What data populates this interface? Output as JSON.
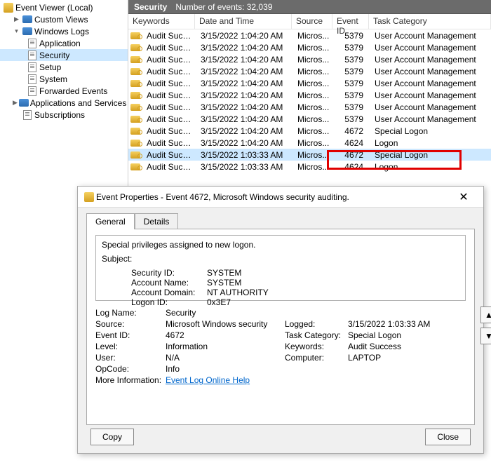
{
  "tree": {
    "root": "Event Viewer (Local)",
    "custom_views": "Custom Views",
    "windows_logs": "Windows Logs",
    "application": "Application",
    "security": "Security",
    "setup": "Setup",
    "system": "System",
    "forwarded": "Forwarded Events",
    "apps_services": "Applications and Services Lo",
    "subscriptions": "Subscriptions"
  },
  "list": {
    "bar_title": "Security",
    "bar_count_label": "Number of events: 32,039",
    "cols": {
      "keywords": "Keywords",
      "datetime": "Date and Time",
      "source": "Source",
      "eventid": "Event ID",
      "task": "Task Category"
    },
    "rows": [
      {
        "k": "Audit Succe...",
        "dt": "3/15/2022 1:04:20 AM",
        "src": "Micros...",
        "eid": "5379",
        "cat": "User Account Management"
      },
      {
        "k": "Audit Succe...",
        "dt": "3/15/2022 1:04:20 AM",
        "src": "Micros...",
        "eid": "5379",
        "cat": "User Account Management"
      },
      {
        "k": "Audit Succe...",
        "dt": "3/15/2022 1:04:20 AM",
        "src": "Micros...",
        "eid": "5379",
        "cat": "User Account Management"
      },
      {
        "k": "Audit Succe...",
        "dt": "3/15/2022 1:04:20 AM",
        "src": "Micros...",
        "eid": "5379",
        "cat": "User Account Management"
      },
      {
        "k": "Audit Succe...",
        "dt": "3/15/2022 1:04:20 AM",
        "src": "Micros...",
        "eid": "5379",
        "cat": "User Account Management"
      },
      {
        "k": "Audit Succe...",
        "dt": "3/15/2022 1:04:20 AM",
        "src": "Micros...",
        "eid": "5379",
        "cat": "User Account Management"
      },
      {
        "k": "Audit Succe...",
        "dt": "3/15/2022 1:04:20 AM",
        "src": "Micros...",
        "eid": "5379",
        "cat": "User Account Management"
      },
      {
        "k": "Audit Succe...",
        "dt": "3/15/2022 1:04:20 AM",
        "src": "Micros...",
        "eid": "5379",
        "cat": "User Account Management"
      },
      {
        "k": "Audit Succe...",
        "dt": "3/15/2022 1:04:20 AM",
        "src": "Micros...",
        "eid": "4672",
        "cat": "Special Logon"
      },
      {
        "k": "Audit Succe...",
        "dt": "3/15/2022 1:04:20 AM",
        "src": "Micros...",
        "eid": "4624",
        "cat": "Logon"
      },
      {
        "k": "Audit Succe...",
        "dt": "3/15/2022 1:03:33 AM",
        "src": "Micros...",
        "eid": "4672",
        "cat": "Special Logon"
      },
      {
        "k": "Audit Succe...",
        "dt": "3/15/2022 1:03:33 AM",
        "src": "Micros...",
        "eid": "4624",
        "cat": "Logon"
      }
    ]
  },
  "dialog": {
    "title": "Event Properties - Event 4672, Microsoft Windows security auditing.",
    "tabs": {
      "general": "General",
      "details": "Details"
    },
    "desc_line1": "Special privileges assigned to new logon.",
    "subject_label": "Subject:",
    "subject": {
      "security_id_k": "Security ID:",
      "security_id_v": "SYSTEM",
      "account_name_k": "Account Name:",
      "account_name_v": "SYSTEM",
      "account_domain_k": "Account Domain:",
      "account_domain_v": "NT AUTHORITY",
      "logon_id_k": "Logon ID:",
      "logon_id_v": "0x3E7"
    },
    "meta": {
      "log_name_k": "Log Name:",
      "log_name_v": "Security",
      "source_k": "Source:",
      "source_v": "Microsoft Windows security",
      "logged_k": "Logged:",
      "logged_v": "3/15/2022 1:03:33 AM",
      "eventid_k": "Event ID:",
      "eventid_v": "4672",
      "taskcat_k": "Task Category:",
      "taskcat_v": "Special Logon",
      "level_k": "Level:",
      "level_v": "Information",
      "keywords_k": "Keywords:",
      "keywords_v": "Audit Success",
      "user_k": "User:",
      "user_v": "N/A",
      "computer_k": "Computer:",
      "computer_v": "LAPTOP",
      "opcode_k": "OpCode:",
      "opcode_v": "Info",
      "moreinfo_k": "More Information:",
      "moreinfo_link": "Event Log Online Help"
    },
    "copy": "Copy",
    "close": "Close"
  }
}
